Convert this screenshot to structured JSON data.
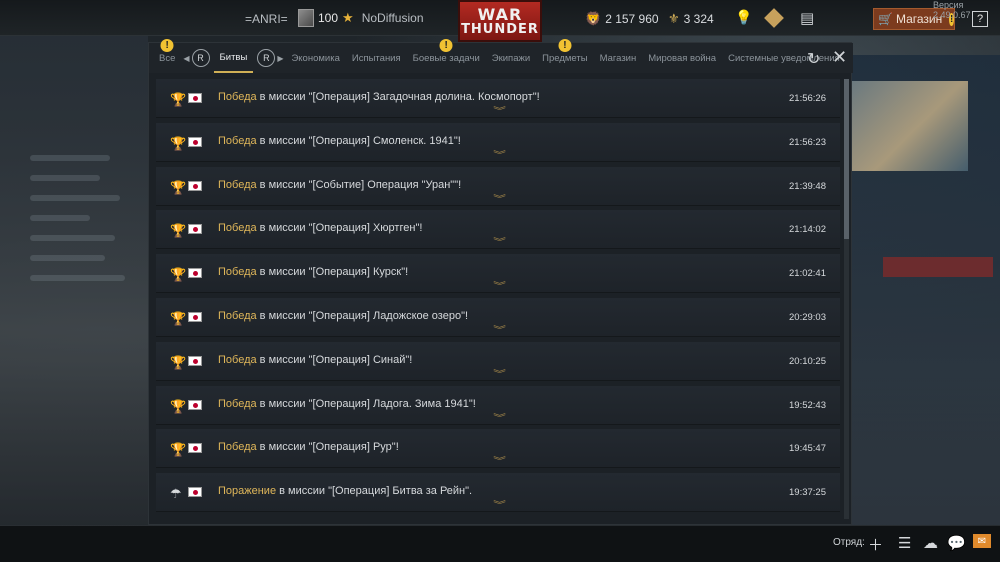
{
  "top_bar": {
    "nickname": "=ANRI=",
    "rank": "100",
    "title": "NoDiffusion",
    "logo_line1": "WAR",
    "logo_line2": "THUNDER",
    "silver_lions": "2 157 960",
    "golden_eagles": "3 324",
    "shop_label": "Магазин",
    "shop_alert": "!",
    "version": "Версия 2.49.0.67",
    "help": "?"
  },
  "tabs": [
    {
      "label": "Все",
      "alert": "!"
    },
    {
      "label": "Битвы",
      "active": true
    },
    {
      "label": "Экономика"
    },
    {
      "label": "Испытания"
    },
    {
      "label": "Боевые задачи",
      "alert": "!"
    },
    {
      "label": "Экипажи"
    },
    {
      "label": "Предметы",
      "alert": "!"
    },
    {
      "label": "Магазин"
    },
    {
      "label": "Мировая война"
    },
    {
      "label": "Системные уведомления"
    }
  ],
  "tab_r_badge": "R",
  "messages": [
    {
      "result": "Победа",
      "text": " в миссии \"[Операция] Загадочная долина. Космопорт\"!",
      "time": "21:56:26"
    },
    {
      "result": "Победа",
      "text": " в миссии \"[Операция] Смоленск. 1941\"!",
      "time": "21:56:23"
    },
    {
      "result": "Победа",
      "text": " в миссии \"[Событие] Операция \"Уран\"\"!",
      "time": "21:39:48"
    },
    {
      "result": "Победа",
      "text": " в миссии \"[Операция] Хюртген\"!",
      "time": "21:14:02"
    },
    {
      "result": "Победа",
      "text": " в миссии \"[Операция] Курск\"!",
      "time": "21:02:41"
    },
    {
      "result": "Победа",
      "text": " в миссии \"[Операция] Ладожское озеро\"!",
      "time": "20:29:03"
    },
    {
      "result": "Победа",
      "text": " в миссии \"[Операция] Синай\"!",
      "time": "20:10:25"
    },
    {
      "result": "Победа",
      "text": " в миссии \"[Операция] Ладога. Зима 1941\"!",
      "time": "19:52:43"
    },
    {
      "result": "Победа",
      "text": " в миссии \"[Операция] Рур\"!",
      "time": "19:45:47"
    },
    {
      "result": "Поражение",
      "text": " в миссии \"[Операция] Битва за Рейн\".",
      "time": "19:37:25"
    }
  ],
  "bottom_bar": {
    "squad_label": "Отряд:"
  },
  "colors": {
    "accent_gold": "#e0b75a",
    "flag_red": "#bc002d",
    "shop_bg": "#7c3b1e"
  }
}
